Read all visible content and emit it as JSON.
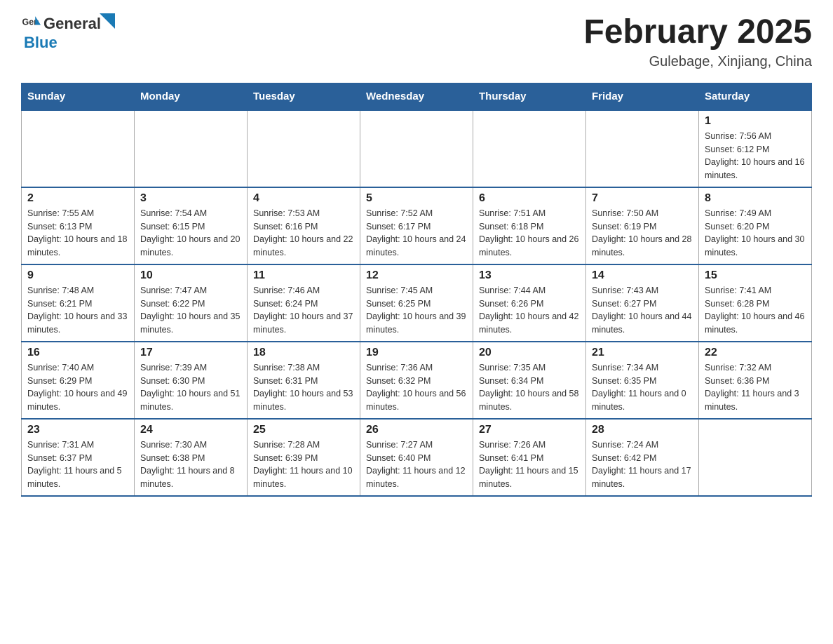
{
  "header": {
    "logo_general": "General",
    "logo_blue": "Blue",
    "month_title": "February 2025",
    "location": "Gulebage, Xinjiang, China"
  },
  "weekdays": [
    "Sunday",
    "Monday",
    "Tuesday",
    "Wednesday",
    "Thursday",
    "Friday",
    "Saturday"
  ],
  "weeks": [
    [
      {
        "day": "",
        "info": ""
      },
      {
        "day": "",
        "info": ""
      },
      {
        "day": "",
        "info": ""
      },
      {
        "day": "",
        "info": ""
      },
      {
        "day": "",
        "info": ""
      },
      {
        "day": "",
        "info": ""
      },
      {
        "day": "1",
        "info": "Sunrise: 7:56 AM\nSunset: 6:12 PM\nDaylight: 10 hours and 16 minutes."
      }
    ],
    [
      {
        "day": "2",
        "info": "Sunrise: 7:55 AM\nSunset: 6:13 PM\nDaylight: 10 hours and 18 minutes."
      },
      {
        "day": "3",
        "info": "Sunrise: 7:54 AM\nSunset: 6:15 PM\nDaylight: 10 hours and 20 minutes."
      },
      {
        "day": "4",
        "info": "Sunrise: 7:53 AM\nSunset: 6:16 PM\nDaylight: 10 hours and 22 minutes."
      },
      {
        "day": "5",
        "info": "Sunrise: 7:52 AM\nSunset: 6:17 PM\nDaylight: 10 hours and 24 minutes."
      },
      {
        "day": "6",
        "info": "Sunrise: 7:51 AM\nSunset: 6:18 PM\nDaylight: 10 hours and 26 minutes."
      },
      {
        "day": "7",
        "info": "Sunrise: 7:50 AM\nSunset: 6:19 PM\nDaylight: 10 hours and 28 minutes."
      },
      {
        "day": "8",
        "info": "Sunrise: 7:49 AM\nSunset: 6:20 PM\nDaylight: 10 hours and 30 minutes."
      }
    ],
    [
      {
        "day": "9",
        "info": "Sunrise: 7:48 AM\nSunset: 6:21 PM\nDaylight: 10 hours and 33 minutes."
      },
      {
        "day": "10",
        "info": "Sunrise: 7:47 AM\nSunset: 6:22 PM\nDaylight: 10 hours and 35 minutes."
      },
      {
        "day": "11",
        "info": "Sunrise: 7:46 AM\nSunset: 6:24 PM\nDaylight: 10 hours and 37 minutes."
      },
      {
        "day": "12",
        "info": "Sunrise: 7:45 AM\nSunset: 6:25 PM\nDaylight: 10 hours and 39 minutes."
      },
      {
        "day": "13",
        "info": "Sunrise: 7:44 AM\nSunset: 6:26 PM\nDaylight: 10 hours and 42 minutes."
      },
      {
        "day": "14",
        "info": "Sunrise: 7:43 AM\nSunset: 6:27 PM\nDaylight: 10 hours and 44 minutes."
      },
      {
        "day": "15",
        "info": "Sunrise: 7:41 AM\nSunset: 6:28 PM\nDaylight: 10 hours and 46 minutes."
      }
    ],
    [
      {
        "day": "16",
        "info": "Sunrise: 7:40 AM\nSunset: 6:29 PM\nDaylight: 10 hours and 49 minutes."
      },
      {
        "day": "17",
        "info": "Sunrise: 7:39 AM\nSunset: 6:30 PM\nDaylight: 10 hours and 51 minutes."
      },
      {
        "day": "18",
        "info": "Sunrise: 7:38 AM\nSunset: 6:31 PM\nDaylight: 10 hours and 53 minutes."
      },
      {
        "day": "19",
        "info": "Sunrise: 7:36 AM\nSunset: 6:32 PM\nDaylight: 10 hours and 56 minutes."
      },
      {
        "day": "20",
        "info": "Sunrise: 7:35 AM\nSunset: 6:34 PM\nDaylight: 10 hours and 58 minutes."
      },
      {
        "day": "21",
        "info": "Sunrise: 7:34 AM\nSunset: 6:35 PM\nDaylight: 11 hours and 0 minutes."
      },
      {
        "day": "22",
        "info": "Sunrise: 7:32 AM\nSunset: 6:36 PM\nDaylight: 11 hours and 3 minutes."
      }
    ],
    [
      {
        "day": "23",
        "info": "Sunrise: 7:31 AM\nSunset: 6:37 PM\nDaylight: 11 hours and 5 minutes."
      },
      {
        "day": "24",
        "info": "Sunrise: 7:30 AM\nSunset: 6:38 PM\nDaylight: 11 hours and 8 minutes."
      },
      {
        "day": "25",
        "info": "Sunrise: 7:28 AM\nSunset: 6:39 PM\nDaylight: 11 hours and 10 minutes."
      },
      {
        "day": "26",
        "info": "Sunrise: 7:27 AM\nSunset: 6:40 PM\nDaylight: 11 hours and 12 minutes."
      },
      {
        "day": "27",
        "info": "Sunrise: 7:26 AM\nSunset: 6:41 PM\nDaylight: 11 hours and 15 minutes."
      },
      {
        "day": "28",
        "info": "Sunrise: 7:24 AM\nSunset: 6:42 PM\nDaylight: 11 hours and 17 minutes."
      },
      {
        "day": "",
        "info": ""
      }
    ]
  ]
}
